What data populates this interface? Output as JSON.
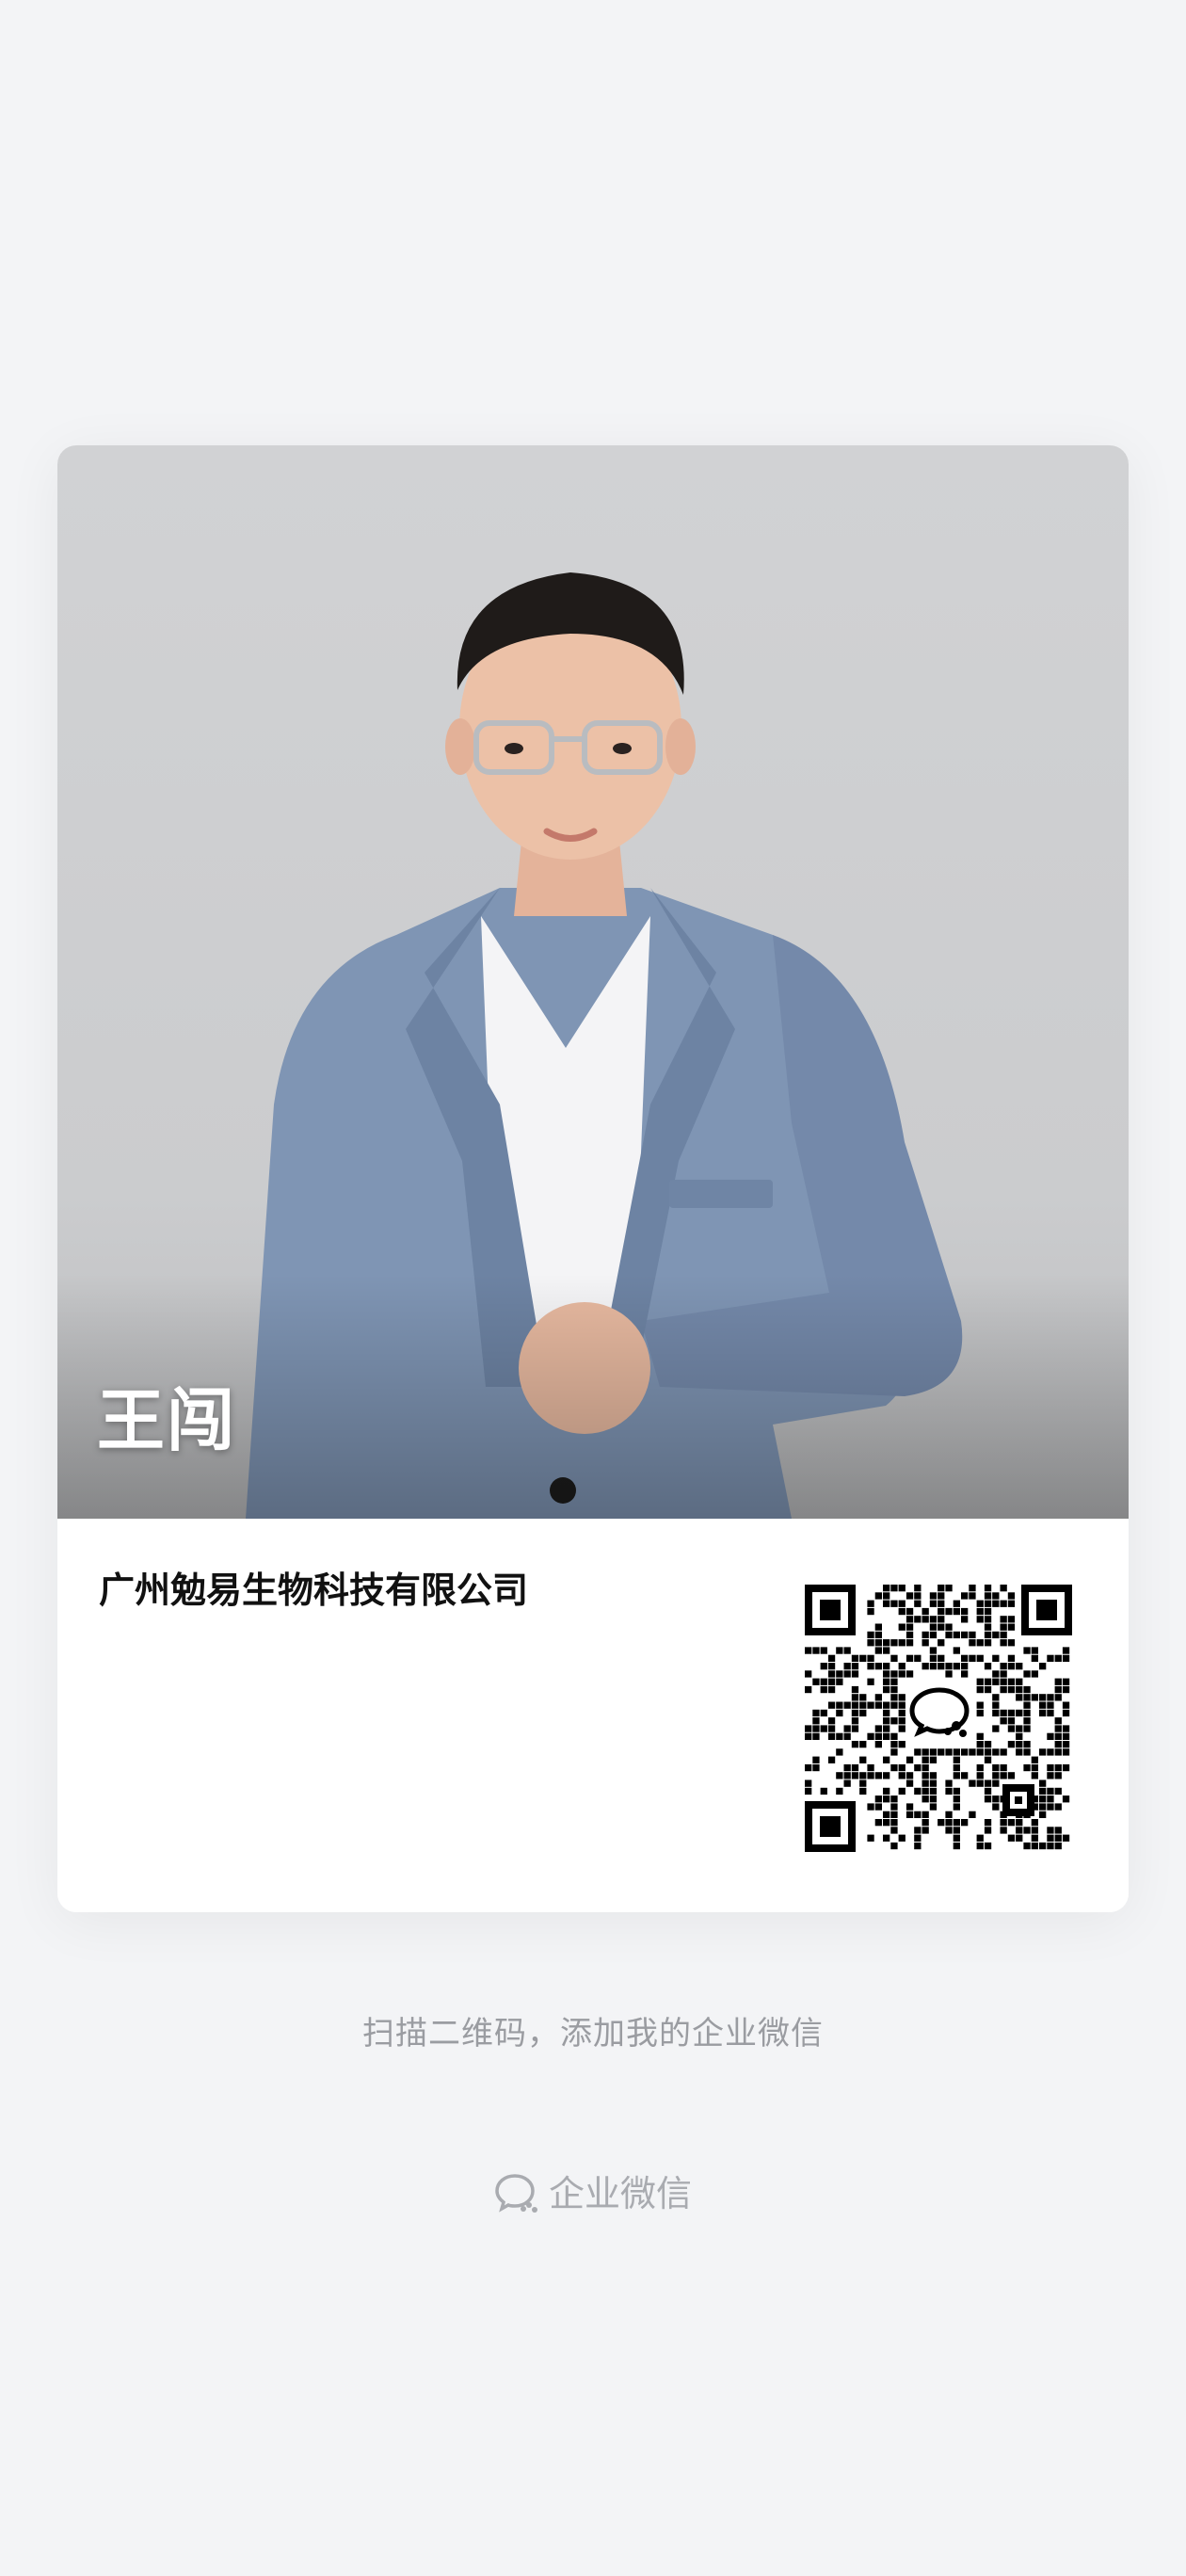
{
  "card": {
    "name": "王闯",
    "company": "广州勉易生物科技有限公司"
  },
  "qr_icon": "wechat-work-logo-icon",
  "hint": "扫描二维码，添加我的企业微信",
  "brand": {
    "icon": "wecom-chat-icon",
    "label": "企业微信"
  },
  "colors": {
    "background": "#f3f4f6",
    "suit": "#7f95b4",
    "hint_text": "#9a9ca1"
  }
}
